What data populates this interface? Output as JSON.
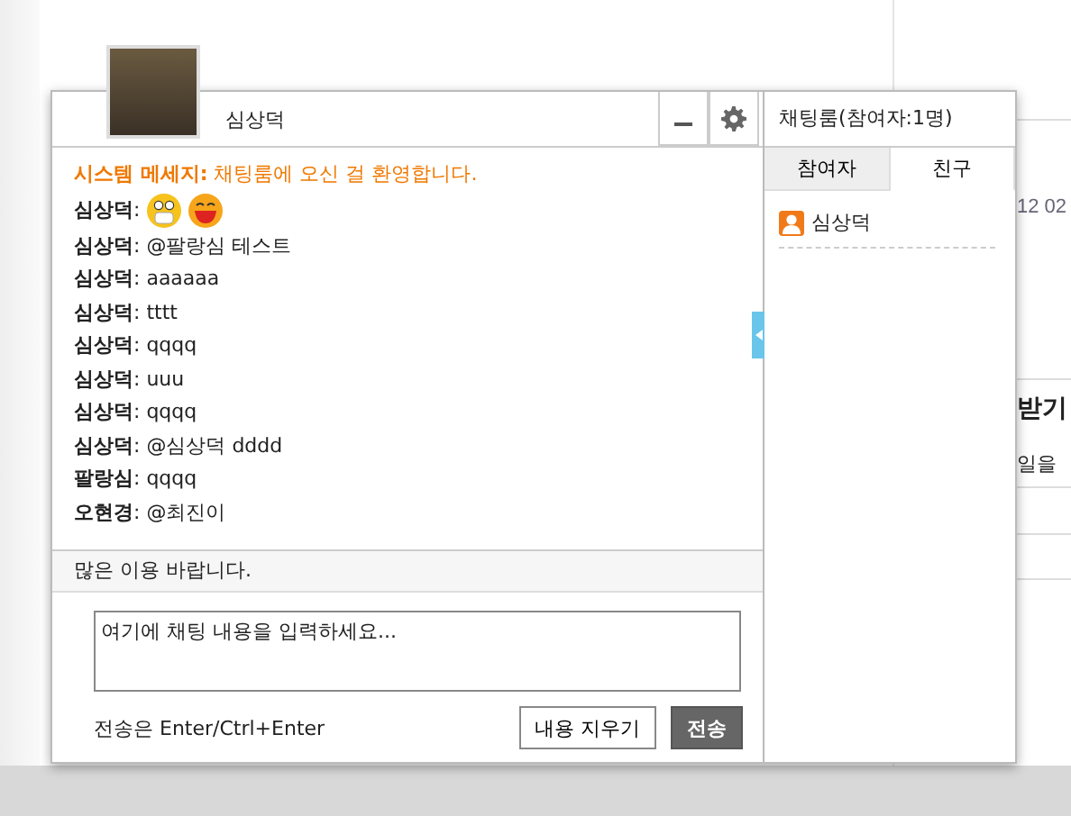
{
  "background_page": {
    "texts": [
      "12 02",
      "받기",
      "일을"
    ]
  },
  "chat_window": {
    "user_name": "심상덕",
    "messages": [
      {
        "kind": "system",
        "text": "**시스템 메세지:** 채팅룸에 오신 걸 환영합니다."
      },
      {
        "kind": "emoji",
        "text": "**심상덕**:"
      },
      {
        "kind": "user",
        "text": "**심상덕**: @팔랑심 테스트"
      },
      {
        "kind": "user",
        "text": "**심상덕**: aaaaaa"
      },
      {
        "kind": "user",
        "text": "**심상덕**: tttt"
      },
      {
        "kind": "user",
        "text": "**심상덕**: qqqq"
      },
      {
        "kind": "user",
        "text": "**심상덕**: uuu"
      },
      {
        "kind": "user",
        "text": "**심상덕**: qqqq"
      },
      {
        "kind": "user",
        "text": "**심상덕**: @심상덕 dddd"
      },
      {
        "kind": "user",
        "text": "**팔랑심**: qqqq"
      },
      {
        "kind": "user",
        "text": "**오현경**: @최진이"
      }
    ],
    "notice": "많은 이용 바랍니다.",
    "input": {
      "placeholder": "여기에 채팅 내용을 입력하세요..."
    },
    "hint": "전송은 Enter/Ctrl+Enter",
    "buttons": [
      {
        "kind": "clear",
        "label": "내용 지우기"
      },
      {
        "kind": "send",
        "label": "전송"
      }
    ]
  },
  "side_panel": {
    "title": "채팅룸(참여자:1명)",
    "tabs": [
      {
        "label": "참여자",
        "selected": false
      },
      {
        "label": "친구",
        "selected": true
      }
    ],
    "friends": [
      {
        "name": "심상덕"
      }
    ]
  }
}
